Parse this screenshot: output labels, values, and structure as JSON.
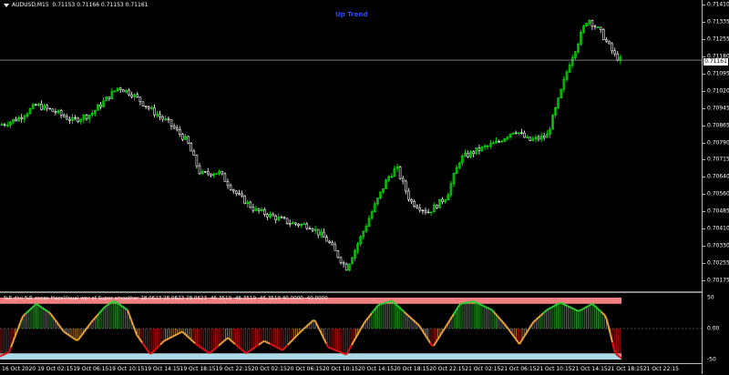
{
  "window": {
    "symbol": "AUDUSD,M15",
    "ohlc": "0.71153 0.71166 0.71153 0.71161",
    "trend_label": "Up Trend"
  },
  "price_axis": {
    "ticks": [
      "0.71410",
      "0.71335",
      "0.71255",
      "0.71180",
      "0.71095",
      "0.71020",
      "0.70945",
      "0.70865",
      "0.70790",
      "0.70715",
      "0.70640",
      "0.70560",
      "0.70485",
      "0.70410",
      "0.70330",
      "0.70255",
      "0.70175"
    ],
    "current_price": "0.71161",
    "ylim": [
      0.70175,
      0.7141
    ]
  },
  "indicator": {
    "header": "%R divi %R zones  HaosVisual wpr of Super smoother 28.0623 28.0623 28.0623 -46.3519 -46.3519 -46.3519 40.0000 -40.0000",
    "axis_ticks": [
      "50",
      "0.00",
      "-50"
    ],
    "colors": {
      "upper_zone": "#f08080",
      "lower_zone": "#add8e6",
      "bull": "#32cd32",
      "bear": "#dc1414",
      "neutral": "#e8a13a"
    }
  },
  "time_axis": {
    "labels": [
      "16 Oct 2020",
      "19 Oct 02:15",
      "19 Oct 06:15",
      "19 Oct 10:15",
      "19 Oct 14:15",
      "19 Oct 18:15",
      "19 Oct 22:15",
      "20 Oct 02:15",
      "20 Oct 06:15",
      "20 Oct 10:15",
      "20 Oct 14:15",
      "20 Oct 18:15",
      "20 Oct 22:15",
      "21 Oct 02:15",
      "21 Oct 06:15",
      "21 Oct 10:15",
      "21 Oct 14:15",
      "21 Oct 18:15",
      "21 Oct 22:15"
    ]
  },
  "colors": {
    "background": "#000000",
    "bull_candle": "#00ff00",
    "bear_candle": "#ffffff",
    "grid": "#bbbbbb"
  }
}
